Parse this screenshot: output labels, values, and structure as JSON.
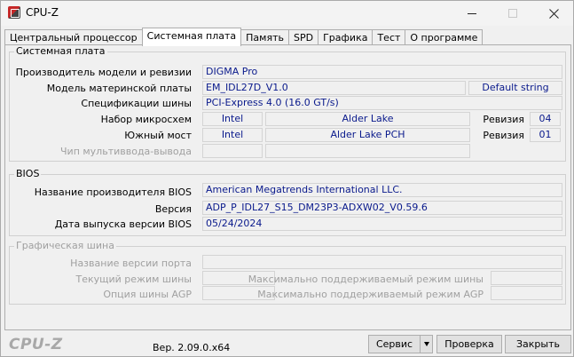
{
  "window": {
    "title": "CPU-Z"
  },
  "tabs": [
    {
      "label": "Центральный процессор"
    },
    {
      "label": "Системная плата"
    },
    {
      "label": "Память"
    },
    {
      "label": "SPD"
    },
    {
      "label": "Графика"
    },
    {
      "label": "Тест"
    },
    {
      "label": "О программе"
    }
  ],
  "active_tab": "Системная плата",
  "motherboard": {
    "group_title": "Системная плата",
    "manufacturer_label": "Производитель модели и ревизии",
    "manufacturer_value": "DIGMA Pro",
    "model_label": "Модель материнской платы",
    "model_value": "EM_IDL27D_V1.0",
    "model_extra": "Default string",
    "bus_label": "Спецификации шины",
    "bus_value": "PCI-Express 4.0 (16.0 GT/s)",
    "chipset_label": "Набор микросхем",
    "chipset_vendor": "Intel",
    "chipset_model": "Alder Lake",
    "chipset_rev_label": "Ревизия",
    "chipset_rev": "04",
    "southbridge_label": "Южный мост",
    "southbridge_vendor": "Intel",
    "southbridge_model": "Alder Lake PCH",
    "southbridge_rev_label": "Ревизия",
    "southbridge_rev": "01",
    "lpcio_label": "Чип мультиввода-вывода"
  },
  "bios": {
    "group_title": "BIOS",
    "brand_label": "Название производителя BIOS",
    "brand_value": "American Megatrends International LLC.",
    "version_label": "Версия",
    "version_value": "ADP_P_IDL27_S15_DM23P3-ADXW02_V0.59.6",
    "date_label": "Дата выпуска версии BIOS",
    "date_value": "05/24/2024"
  },
  "graphic_bus": {
    "group_title": "Графическая шина",
    "version_label": "Название версии порта",
    "link_width_label": "Текущий режим шины",
    "max_supported_label": "Максимально поддерживаемый режим шины",
    "side_band_label": "Опция шины AGP",
    "max_agp_label": "Максимально поддерживаемый режим AGP"
  },
  "footer": {
    "logo": "CPU-Z",
    "version": "Вер. 2.09.0.x64",
    "service_label": "Сервис",
    "validate_label": "Проверка",
    "close_label": "Закрыть"
  },
  "icons": {
    "app": "cpu-z-app-icon",
    "minimize": "minimize-icon",
    "maximize": "maximize-icon",
    "close": "close-icon",
    "dropdown": "chevron-down-icon"
  },
  "colors": {
    "value_text": "#0a1a8c",
    "disabled_text": "#a0a0a0",
    "background": "#f0f0f0"
  }
}
